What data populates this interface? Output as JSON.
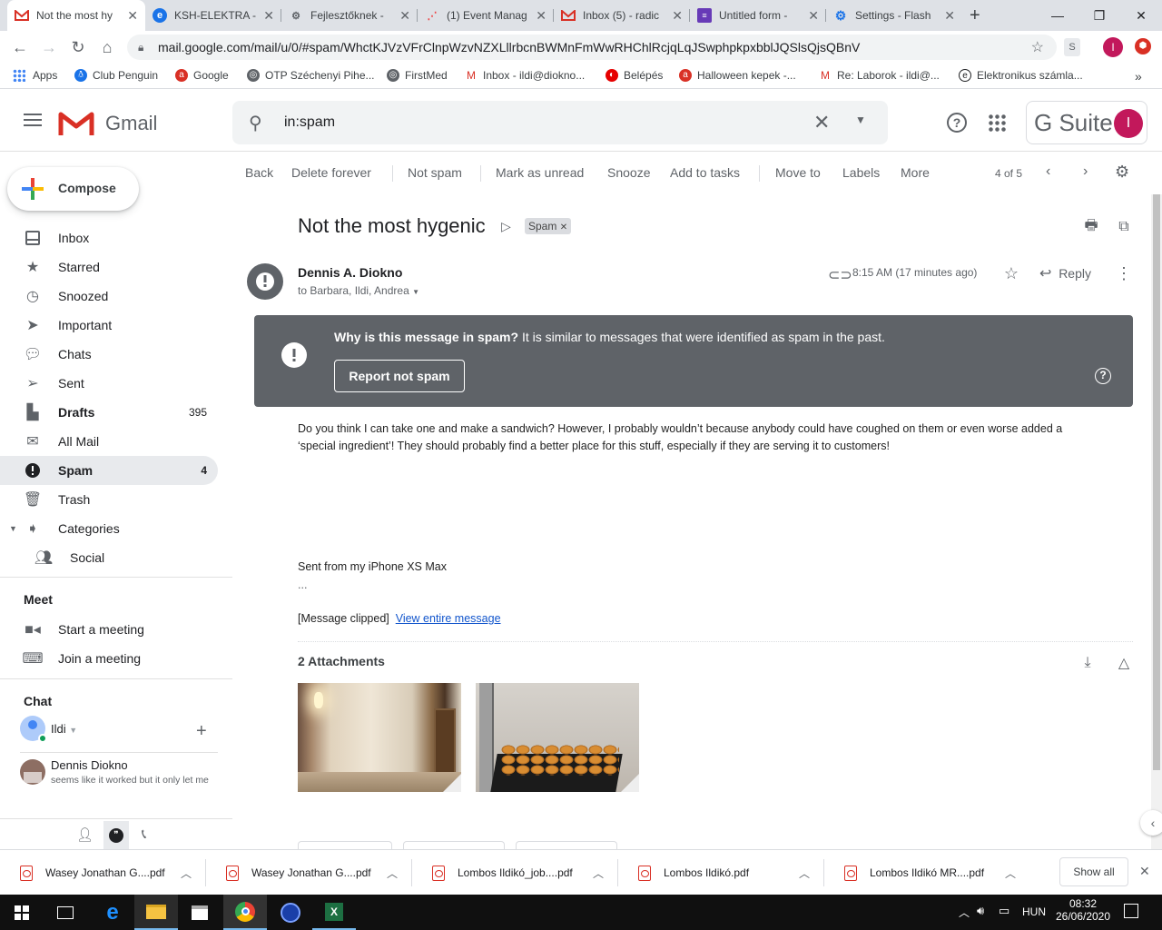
{
  "browser": {
    "tabs": [
      {
        "title": "Not the most hy",
        "favicon": "gmail-icon",
        "active": true
      },
      {
        "title": "KSH-ELEKTRA -",
        "favicon": "globe-icon"
      },
      {
        "title": "Fejlesztőknek -",
        "favicon": "puzzle-icon"
      },
      {
        "title": "(1) Event Manag",
        "favicon": "monday-icon"
      },
      {
        "title": "Inbox (5) - radic",
        "favicon": "gmail-icon"
      },
      {
        "title": "Untitled form -",
        "favicon": "forms-icon"
      },
      {
        "title": "Settings - Flash",
        "favicon": "settings-icon"
      }
    ],
    "url": "mail.google.com/mail/u/0/#spam/WhctKJVzVFrClnpWzvNZXLllrbcnBWMnFmWwRHChlRcjqLqJSwphpkpxbblJQSlsQjsQBnV",
    "bookmarks": [
      "Apps",
      "Club Penguin",
      "Google",
      "OTP Széchenyi Pihe...",
      "FirstMed",
      "Inbox - ildi@diokno...",
      "Belépés",
      "Halloween kepek -...",
      "Re: Laborok - ildi@...",
      "Elektronikus számla..."
    ],
    "profile_initial": "I"
  },
  "gmail": {
    "logo_text": "Gmail",
    "search_value": "in:spam",
    "gsuite_label": "G Suite",
    "avatar_initial": "I",
    "compose_label": "Compose",
    "nav": [
      {
        "label": "Inbox",
        "icon": "inbox-icon",
        "count": ""
      },
      {
        "label": "Starred",
        "icon": "star-icon",
        "count": ""
      },
      {
        "label": "Snoozed",
        "icon": "clock-icon",
        "count": ""
      },
      {
        "label": "Important",
        "icon": "important-icon",
        "count": ""
      },
      {
        "label": "Chats",
        "icon": "chat-icon",
        "count": ""
      },
      {
        "label": "Sent",
        "icon": "send-icon",
        "count": ""
      },
      {
        "label": "Drafts",
        "icon": "draft-icon",
        "count": "395"
      },
      {
        "label": "All Mail",
        "icon": "mail-icon",
        "count": ""
      },
      {
        "label": "Spam",
        "icon": "spam-icon",
        "count": "4"
      },
      {
        "label": "Trash",
        "icon": "trash-icon",
        "count": ""
      },
      {
        "label": "Categories",
        "icon": "label-icon",
        "count": ""
      },
      {
        "label": "Social",
        "icon": "people-icon",
        "count": ""
      }
    ],
    "meet": {
      "heading": "Meet",
      "start": "Start a meeting",
      "join": "Join a meeting"
    },
    "chat": {
      "heading": "Chat",
      "self_name": "Ildi",
      "contact_name": "Dennis Diokno",
      "contact_preview": "seems like it worked but it only let me"
    },
    "toolbar": {
      "back": "Back",
      "delete_forever": "Delete forever",
      "not_spam": "Not spam",
      "mark_unread": "Mark as unread",
      "snooze": "Snooze",
      "add_tasks": "Add to tasks",
      "move_to": "Move to",
      "labels": "Labels",
      "more": "More",
      "pager": "4 of 5"
    },
    "message": {
      "subject": "Not the most hygenic",
      "label_chip": "Spam",
      "sender": "Dennis A. Diokno",
      "recipients": "to Barbara, Ildi, Andrea",
      "time": "8:15 AM (17 minutes ago)",
      "reply_label": "Reply",
      "spam_banner_bold": "Why is this message in spam?",
      "spam_banner_text": " It is similar to messages that were identified as spam in the past.",
      "report_button": "Report not spam",
      "body_line1": "Do you think I can take one and make a sandwich? However, I probably wouldn’t because anybody could have coughed on them or even worse added a",
      "body_line2": "‘special ingredient’! They should probably find a better place for this stuff, especially if they are serving it to customers!",
      "signature": "Sent from my iPhone XS Max",
      "ellipsis": "...",
      "clipped": "[Message clipped]",
      "view_entire": "View entire message",
      "attachments_heading": "2 Attachments"
    }
  },
  "downloads": {
    "items": [
      "Wasey Jonathan G....pdf",
      "Wasey Jonathan G....pdf",
      "Lombos Ildikó_job....pdf",
      "Lombos Ildikó.pdf",
      "Lombos Ildikó MR....pdf"
    ],
    "show_all": "Show all"
  },
  "taskbar": {
    "lang": "HUN",
    "time": "08:32",
    "date": "26/06/2020"
  }
}
